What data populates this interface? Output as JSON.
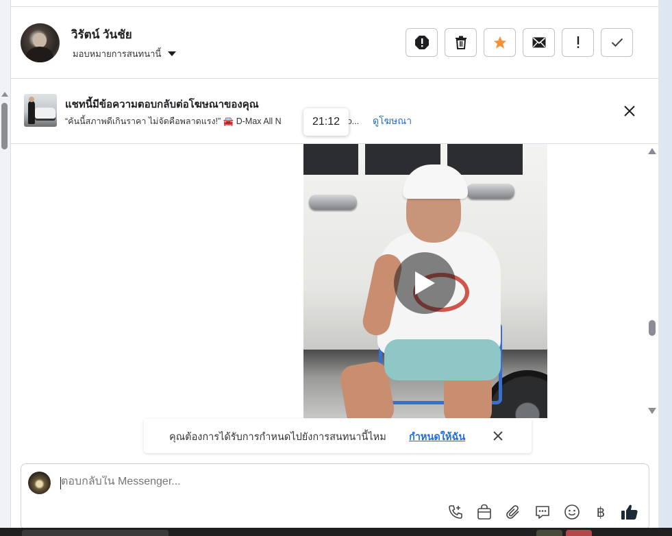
{
  "header": {
    "contact_name": "วิรัตน์ วันชัย",
    "assign_label": "มอบหมายการสนทนานี้",
    "actions": [
      {
        "name": "spam-button",
        "icon": "alert-circle-icon"
      },
      {
        "name": "delete-button",
        "icon": "trash-icon"
      },
      {
        "name": "star-button",
        "icon": "star-icon",
        "color": "#f7923b"
      },
      {
        "name": "mark-unread-button",
        "icon": "envelope-icon"
      },
      {
        "name": "follow-up-button",
        "icon": "exclamation-icon"
      },
      {
        "name": "done-button",
        "icon": "check-icon"
      }
    ]
  },
  "ad_banner": {
    "title": "แชทนี้มีข้อความตอบกลับต่อโฆษณาของคุณ",
    "text": "“คันนี้สภาพดีเกินราคา ไม่จัดคือพลาดแรง!” 🚘 D-Max All N",
    "text_ellipsis": "o...",
    "link": "ดูโฆษณา"
  },
  "tooltip": {
    "time": "21:12"
  },
  "assign_prompt": {
    "text": "คุณต้องการได้รับการกำหนดไปยังการสนทนานี้ไหม",
    "link": "กำหนดให้ฉัน"
  },
  "composer": {
    "placeholder": "ตอบกลับใน Messenger...",
    "currency_symbol": "฿",
    "tools": [
      "phone-add-icon",
      "bag-icon",
      "paperclip-icon",
      "chat-bubble-icon",
      "smiley-icon",
      "baht-icon",
      "thumbs-up-icon"
    ]
  },
  "colors": {
    "accent": "#216fdb",
    "star": "#f7923b",
    "border": "#dadde1"
  }
}
